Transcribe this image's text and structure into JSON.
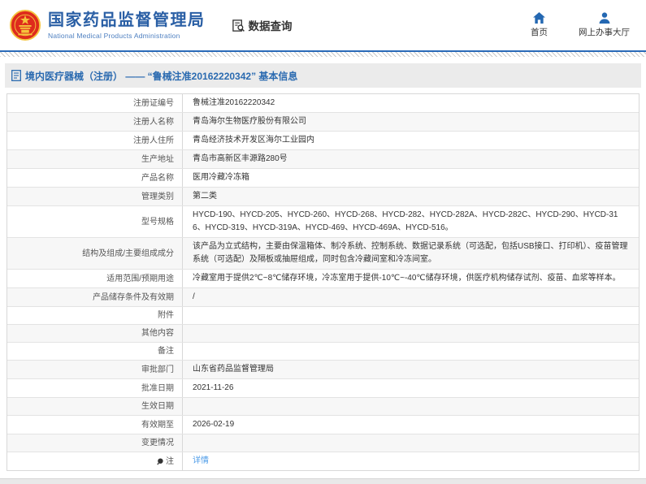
{
  "header": {
    "logo": {
      "title": "国家药品监督管理局",
      "subtitle": "National Medical Products Administration",
      "emblem_icon": "china-national-emblem"
    },
    "nav": {
      "data_query_label": "数据查询"
    },
    "links": [
      {
        "label": "首页",
        "icon": "home-icon"
      },
      {
        "label": "网上办事大厅",
        "icon": "person-icon"
      }
    ]
  },
  "title_bar": {
    "text": "境内医疗器械（注册） —— “鲁械注准20162220342” 基本信息"
  },
  "table": {
    "rows": [
      {
        "label": "注册证编号",
        "value": "鲁械注准20162220342"
      },
      {
        "label": "注册人名称",
        "value": "青岛海尔生物医疗股份有限公司"
      },
      {
        "label": "注册人住所",
        "value": "青岛经济技术开发区海尔工业园内"
      },
      {
        "label": "生产地址",
        "value": "青岛市高新区丰源路280号"
      },
      {
        "label": "产品名称",
        "value": "医用冷藏冷冻箱"
      },
      {
        "label": "管理类别",
        "value": "第二类"
      },
      {
        "label": "型号规格",
        "value": "HYCD-190、HYCD-205、HYCD-260、HYCD-268、HYCD-282、HYCD-282A、HYCD-282C、HYCD-290、HYCD-316、HYCD-319、HYCD-319A、HYCD-469、HYCD-469A、HYCD-516。"
      },
      {
        "label": "结构及组成/主要组成成分",
        "value": "该产品为立式结构，主要由保温箱体、制冷系统、控制系统、数据记录系统（可选配，包括USB接口、打印机）、疫苗管理系统（可选配）及隔板或抽屉组成，同时包含冷藏间室和冷冻间室。"
      },
      {
        "label": "适用范围/预期用途",
        "value": "冷藏室用于提供2℃~8℃储存环境，冷冻室用于提供-10℃~-40℃储存环境，供医疗机构储存试剂、疫苗、血浆等样本。"
      },
      {
        "label": "产品储存条件及有效期",
        "value": "/"
      },
      {
        "label": "附件",
        "value": ""
      },
      {
        "label": "其他内容",
        "value": ""
      },
      {
        "label": "备注",
        "value": ""
      },
      {
        "label": "审批部门",
        "value": "山东省药品监督管理局"
      },
      {
        "label": "批准日期",
        "value": "2021-11-26"
      },
      {
        "label": "生效日期",
        "value": ""
      },
      {
        "label": "有效期至",
        "value": "2026-02-19"
      },
      {
        "label": "变更情况",
        "value": ""
      },
      {
        "label": "注",
        "value": "详情",
        "value_is_link": true,
        "label_icon": "note-icon"
      }
    ]
  },
  "colors": {
    "accent_blue": "#2a6ab8",
    "logo_blue": "#2a5fa5",
    "title_text_blue": "#2a6ab0",
    "link_blue": "#4c9be8",
    "emblem_red": "#de2b1c",
    "emblem_gold": "#f5c33c",
    "zebra_gray": "#f7f7f7",
    "bar_gray": "#ebebeb"
  }
}
